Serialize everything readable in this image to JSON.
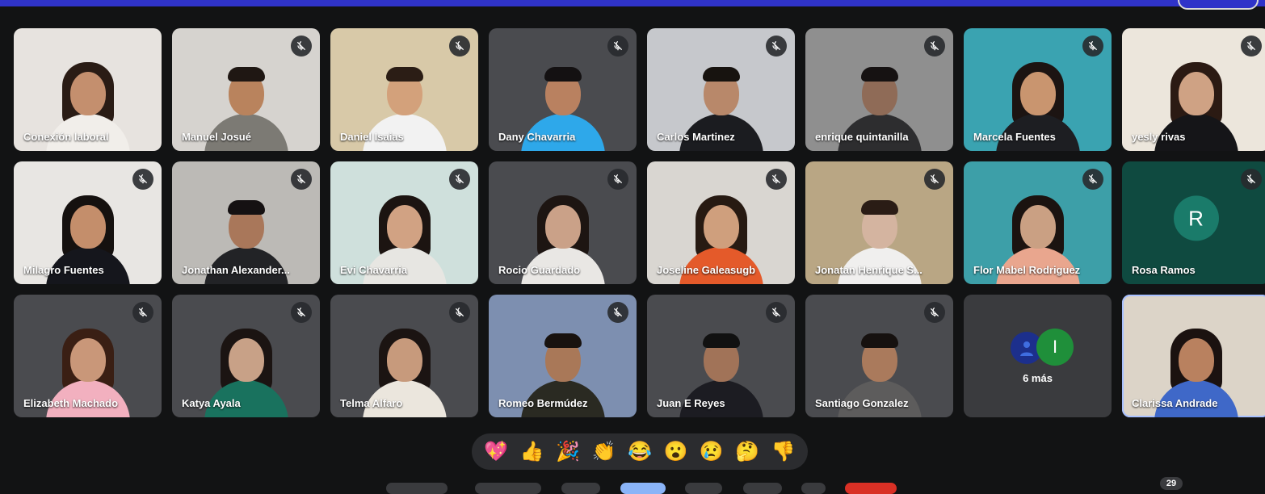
{
  "participants": [
    {
      "name": "Conexión laboral",
      "bg": "#e7e3df",
      "skin": "#c48f6e",
      "hair": "#2a1c15",
      "shirt": "#f1eeea",
      "longhair": true,
      "muted": false
    },
    {
      "name": "Manuel Josué",
      "bg": "#d6d3cf",
      "skin": "#b9835d",
      "hair": "#1f1713",
      "shirt": "#7c7a74",
      "longhair": false,
      "muted": true
    },
    {
      "name": "Daniel Isaias",
      "bg": "#d8c9a8",
      "skin": "#d3a17b",
      "hair": "#2b1d15",
      "shirt": "#f2f2f2",
      "longhair": false,
      "muted": true
    },
    {
      "name": "Dany Chavarria",
      "bg": "#4a4b4f",
      "skin": "#b98160",
      "hair": "#141112",
      "shirt": "#2ea8ea",
      "longhair": false,
      "muted": true
    },
    {
      "name": "Carlos Martinez",
      "bg": "#c6c8cc",
      "skin": "#b8886a",
      "hair": "#17130f",
      "shirt": "#1b1c20",
      "longhair": false,
      "muted": true
    },
    {
      "name": "enrique quintanilla",
      "bg": "#8f8f8f",
      "skin": "#8f6b57",
      "hair": "#161212",
      "shirt": "#2d2d2f",
      "longhair": false,
      "muted": true
    },
    {
      "name": "Marcela Fuentes",
      "bg": "#3aa3b1",
      "skin": "#c9956f",
      "hair": "#1c1412",
      "shirt": "#1d1e22",
      "longhair": true,
      "muted": true
    },
    {
      "name": "yesly rivas",
      "bg": "#ece6dc",
      "skin": "#cfa284",
      "hair": "#2b1a13",
      "shirt": "#151518",
      "longhair": true,
      "muted": true
    },
    {
      "name": "Milagro Fuentes",
      "bg": "#e8e6e3",
      "skin": "#c48e6b",
      "hair": "#15110f",
      "shirt": "#15161c",
      "longhair": true,
      "muted": true
    },
    {
      "name": "Jonathan Alexander...",
      "bg": "#bcbab6",
      "skin": "#a9775a",
      "hair": "#151112",
      "shirt": "#222326",
      "longhair": false,
      "muted": true
    },
    {
      "name": "Evi Chavarria",
      "bg": "#cfe0dc",
      "skin": "#d1a283",
      "hair": "#1c1411",
      "shirt": "#e7e6e2",
      "longhair": true,
      "muted": true
    },
    {
      "name": "Rocio Guardado",
      "bg": "#4a4b4f",
      "skin": "#caa188",
      "hair": "#1d1512",
      "shirt": "#e9e7e4",
      "longhair": true,
      "muted": true
    },
    {
      "name": "Joseline Galeasugb",
      "bg": "#d9d6d1",
      "skin": "#cf9f7d",
      "hair": "#271a12",
      "shirt": "#e45a2a",
      "longhair": true,
      "muted": true
    },
    {
      "name": "Jonatan Henrique S...",
      "bg": "#b9a684",
      "skin": "#d4b4a0",
      "hair": "#2a1c15",
      "shirt": "#f0efee",
      "longhair": false,
      "muted": true
    },
    {
      "name": "Flor Mabel Rodriguez",
      "bg": "#3d9fa8",
      "skin": "#caa083",
      "hair": "#1b1310",
      "shirt": "#e9a68e",
      "longhair": true,
      "muted": true
    },
    {
      "name": "Rosa Ramos",
      "bg": "#0f4a40",
      "avatar": "R",
      "muted": true
    },
    {
      "name": "Elizabeth Machado",
      "bg": "#4a4b4f",
      "skin": "#c99779",
      "hair": "#3a1f14",
      "shirt": "#f2b0bf",
      "longhair": true,
      "muted": true
    },
    {
      "name": "Katya Ayala",
      "bg": "#4a4b4f",
      "skin": "#c8a187",
      "hair": "#1b1412",
      "shirt": "#19725e",
      "longhair": true,
      "muted": true
    },
    {
      "name": "Telma Alfaro",
      "bg": "#4a4b4f",
      "skin": "#c79a7c",
      "hair": "#1b1412",
      "shirt": "#ebe6dd",
      "longhair": true,
      "muted": true
    },
    {
      "name": "Romeo Bermúdez",
      "bg": "#7d8fb0",
      "skin": "#a97858",
      "hair": "#18120f",
      "shirt": "#2a2a22",
      "longhair": false,
      "muted": true
    },
    {
      "name": "Juan E Reyes",
      "bg": "#4a4b4f",
      "skin": "#a17358",
      "hair": "#111",
      "shirt": "#1c1c22",
      "longhair": false,
      "muted": true
    },
    {
      "name": "Santiago Gonzalez",
      "bg": "#4a4b4f",
      "skin": "#aa7a5c",
      "hair": "#16110f",
      "shirt": "#5d5c5c",
      "longhair": false,
      "muted": true
    },
    {
      "more": "6 más",
      "more_initial": "I",
      "muted": false
    },
    {
      "name": "Clarissa Andrade",
      "bg": "#dcd4c8",
      "skin": "#b9815f",
      "hair": "#1b1210",
      "shirt": "#3f68c8",
      "longhair": true,
      "muted": false,
      "selected": true
    }
  ],
  "reactions": [
    "💖",
    "👍",
    "🎉",
    "👏",
    "😂",
    "😮",
    "😢",
    "🤔",
    "👎"
  ],
  "participant_count": "29"
}
